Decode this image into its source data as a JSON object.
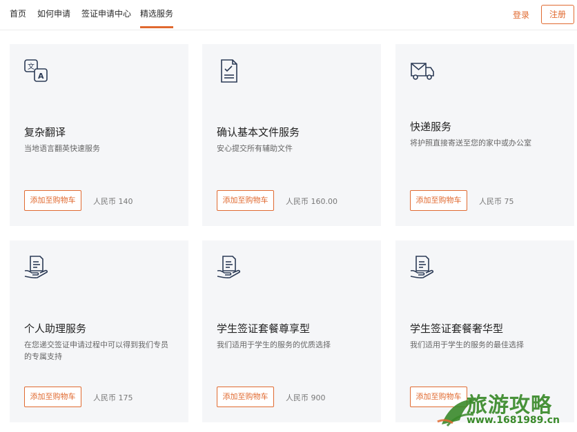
{
  "nav": {
    "items": [
      "首页",
      "如何申请",
      "签证申请中心",
      "精选服务"
    ],
    "active_index": 3,
    "login": "登录",
    "register": "注册"
  },
  "cards": [
    {
      "icon": "translate-icon",
      "title": "复杂翻译",
      "desc": "当地语言翻英快速服务",
      "button": "添加至购物车",
      "price": "人民币 140"
    },
    {
      "icon": "document-check-icon",
      "title": "确认基本文件服务",
      "desc": "安心提交所有辅助文件",
      "button": "添加至购物车",
      "price": "人民币 160.00"
    },
    {
      "icon": "delivery-truck-icon",
      "title": "快递服务",
      "desc": "将护照直接寄送至您的家中或办公室",
      "button": "添加至购物车",
      "price": "人民币 75"
    },
    {
      "icon": "document-hand-icon",
      "title": "个人助理服务",
      "desc": "在您递交签证申请过程中可以得到我们专员的专属支持",
      "button": "添加至购物车",
      "price": "人民币 175"
    },
    {
      "icon": "document-hand-icon",
      "title": "学生签证套餐尊享型",
      "desc": "我们适用于学生的服务的优质选择",
      "button": "添加至购物车",
      "price": "人民币 900"
    },
    {
      "icon": "document-hand-icon",
      "title": "学生签证套餐奢华型",
      "desc": "我们适用于学生的服务的最佳选择",
      "button": "添加至购物车",
      "price": ""
    }
  ],
  "watermark": {
    "text": "旅游攻略",
    "url": "www.1681989.cn"
  },
  "colors": {
    "accent": "#e0692f",
    "card_bg": "#f5f6f8",
    "icon": "#2b3a55",
    "watermark": "#3a8a2a"
  }
}
